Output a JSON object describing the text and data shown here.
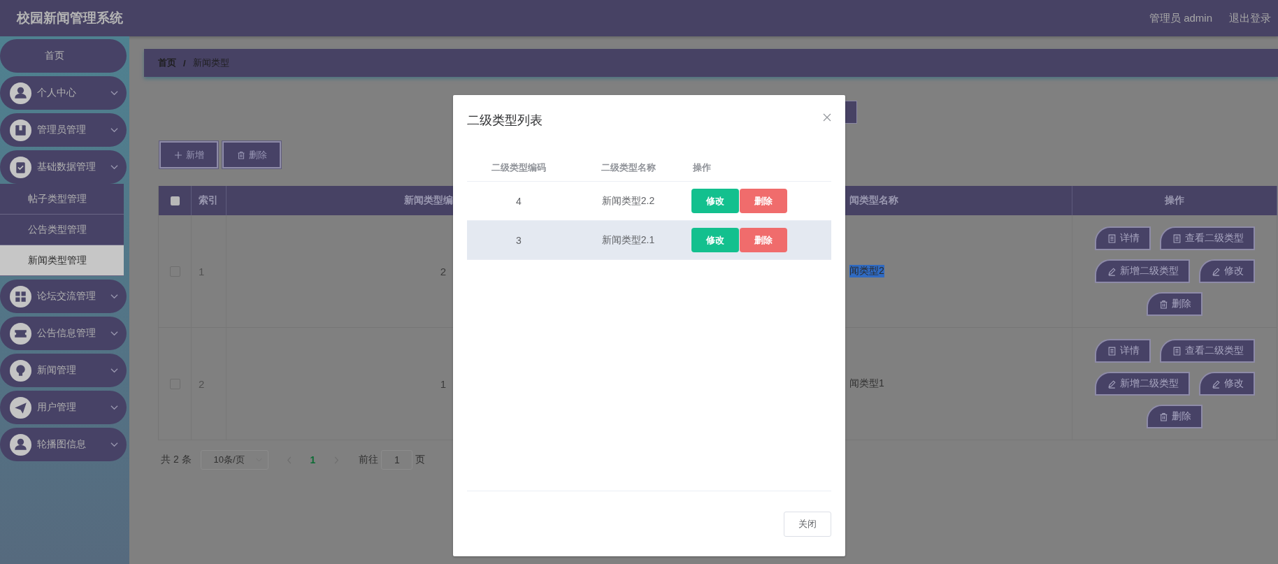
{
  "header": {
    "title": "校园新闻管理系统",
    "user_label": "管理员 admin",
    "logout": "退出登录"
  },
  "sidebar": {
    "items": [
      {
        "label": "首页",
        "kind": "plain"
      },
      {
        "label": "个人中心",
        "kind": "menu"
      },
      {
        "label": "管理员管理",
        "kind": "menu"
      },
      {
        "label": "基础数据管理",
        "kind": "menu",
        "children": [
          {
            "label": "帖子类型管理",
            "selected": false
          },
          {
            "label": "公告类型管理",
            "selected": false
          },
          {
            "label": "新闻类型管理",
            "selected": true
          }
        ]
      },
      {
        "label": "论坛交流管理",
        "kind": "menu"
      },
      {
        "label": "公告信息管理",
        "kind": "menu"
      },
      {
        "label": "新闻管理",
        "kind": "menu"
      },
      {
        "label": "用户管理",
        "kind": "menu"
      },
      {
        "label": "轮播图信息",
        "kind": "menu"
      }
    ]
  },
  "breadcrumb": {
    "items": [
      "首页",
      "新闻类型"
    ],
    "separator": "/"
  },
  "toolbar": [
    {
      "label": "新增",
      "kind": "add"
    },
    {
      "label": "删除",
      "kind": "delete"
    }
  ],
  "table": {
    "header_checked": false,
    "columns": [
      "索引",
      "新闻类型编",
      "闻类型名称",
      "操作"
    ],
    "rows": [
      {
        "checked": false,
        "index": "1",
        "code": "2",
        "name": "闻类型2",
        "text_selected": true,
        "actions": [
          {
            "label": "详情",
            "kind": "detail"
          },
          {
            "label": "查看二级类型",
            "kind": "detail"
          },
          {
            "label": "新增二级类型",
            "kind": "edit"
          },
          {
            "label": "修改",
            "kind": "edit"
          },
          {
            "label": "删除",
            "kind": "delete"
          }
        ]
      },
      {
        "checked": false,
        "index": "2",
        "code": "1",
        "name": "闻类型1",
        "text_selected": false,
        "actions": [
          {
            "label": "详情",
            "kind": "detail"
          },
          {
            "label": "查看二级类型",
            "kind": "detail"
          },
          {
            "label": "新增二级类型",
            "kind": "edit"
          },
          {
            "label": "修改",
            "kind": "edit"
          },
          {
            "label": "删除",
            "kind": "delete"
          }
        ]
      }
    ]
  },
  "pagination": {
    "total": "共 2 条",
    "page_size": "10条/页",
    "pages": [
      {
        "label": "1",
        "selected": true
      }
    ],
    "goto_label": "前往",
    "goto_value": "1",
    "page_suffix": "页"
  },
  "modal": {
    "title": "二级类型列表",
    "columns": [
      "二级类型编码",
      "二级类型名称",
      "操作"
    ],
    "rows": [
      {
        "code": "4",
        "name": "新闻类型2.2",
        "hovered": false,
        "actions": [
          {
            "label": "修改",
            "kind": "edit"
          },
          {
            "label": "删除",
            "kind": "delete"
          }
        ]
      },
      {
        "code": "3",
        "name": "新闻类型2.1",
        "hovered": true,
        "actions": [
          {
            "label": "修改",
            "kind": "edit"
          },
          {
            "label": "删除",
            "kind": "delete"
          }
        ]
      }
    ],
    "close_button": "关闭"
  }
}
